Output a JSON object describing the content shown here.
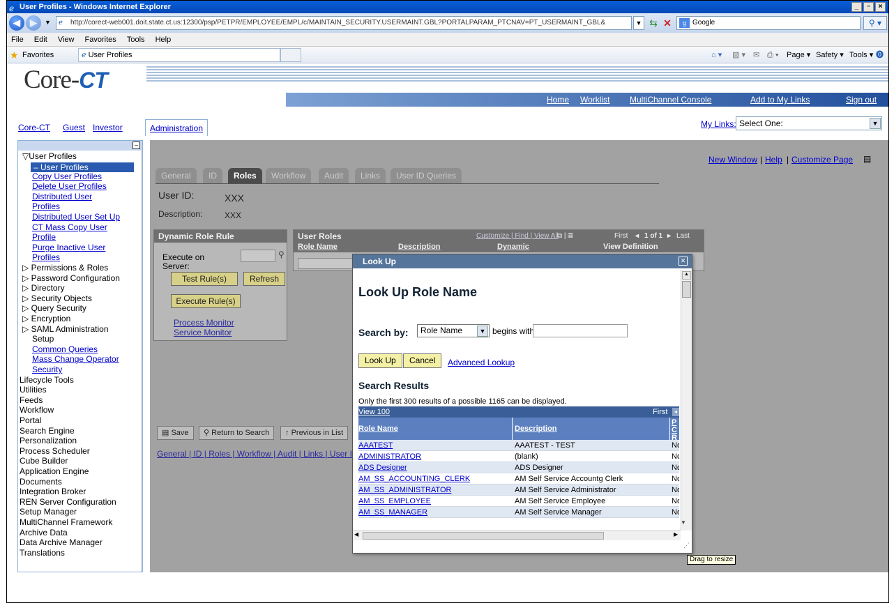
{
  "window": {
    "title": "User Profiles - Windows Internet Explorer"
  },
  "browser": {
    "url": "http://corect-web001.doit.state.ct.us:12300/psp/PETPR/EMPLOYEE/EMPL/c/MAINTAIN_SECURITY.USERMAINT.GBL?PORTALPARAM_PTCNAV=PT_USERMAINT_GBL&",
    "search_engine": "Google",
    "menus": [
      "File",
      "Edit",
      "View",
      "Favorites",
      "Tools",
      "Help"
    ],
    "favorites": "Favorites",
    "tab": "User Profiles",
    "cmd": [
      "Page ▾",
      "Safety ▾",
      "Tools ▾"
    ]
  },
  "header": {
    "logo_text": "Core-",
    "logo_ct": "CT",
    "links": [
      "Home",
      "Worklist",
      "MultiChannel Console",
      "Add to My Links",
      "Sign out"
    ],
    "tabs": [
      "Core-CT",
      "Guest",
      "Investor",
      "Administration"
    ],
    "my_links_label": "My Links:",
    "my_links_value": "Select One:"
  },
  "menu": {
    "items": [
      {
        "label": "▽User Profiles",
        "type": "top"
      },
      {
        "label": "– User Profiles",
        "type": "selected"
      },
      {
        "label": "Copy User Profiles",
        "type": "sub"
      },
      {
        "label": "Delete User Profiles",
        "type": "sub"
      },
      {
        "label": "Distributed User",
        "type": "sub"
      },
      {
        "label": "Profiles",
        "type": "sub"
      },
      {
        "label": "Distributed User Set Up",
        "type": "sub"
      },
      {
        "label": "CT Mass Copy User",
        "type": "sub"
      },
      {
        "label": "Profile",
        "type": "sub"
      },
      {
        "label": "Purge Inactive User",
        "type": "sub"
      },
      {
        "label": "Profiles",
        "type": "sub"
      },
      {
        "label": "▷ Permissions & Roles",
        "type": "top"
      },
      {
        "label": "▷ Password Configuration",
        "type": "top"
      },
      {
        "label": "▷ Directory",
        "type": "top"
      },
      {
        "label": "▷ Security Objects",
        "type": "top"
      },
      {
        "label": "▷ Query Security",
        "type": "top"
      },
      {
        "label": "▷ Encryption",
        "type": "top"
      },
      {
        "label": "▷ SAML Administration",
        "type": "top"
      },
      {
        "label": "Setup",
        "type": "indent"
      },
      {
        "label": "Common Queries",
        "type": "sub"
      },
      {
        "label": "Mass Change Operator",
        "type": "sub"
      },
      {
        "label": "Security",
        "type": "sub"
      },
      {
        "label": "Lifecycle Tools",
        "type": "root"
      },
      {
        "label": "Utilities",
        "type": "root"
      },
      {
        "label": "Feeds",
        "type": "root"
      },
      {
        "label": "Workflow",
        "type": "root"
      },
      {
        "label": "Portal",
        "type": "root"
      },
      {
        "label": "Search Engine",
        "type": "root"
      },
      {
        "label": "Personalization",
        "type": "root"
      },
      {
        "label": "Process Scheduler",
        "type": "root"
      },
      {
        "label": "Cube Builder",
        "type": "root"
      },
      {
        "label": "Application Engine",
        "type": "root"
      },
      {
        "label": "Documents",
        "type": "root"
      },
      {
        "label": "Integration Broker",
        "type": "root"
      },
      {
        "label": "REN Server Configuration",
        "type": "root"
      },
      {
        "label": "Setup Manager",
        "type": "root"
      },
      {
        "label": "MultiChannel Framework",
        "type": "root"
      },
      {
        "label": "Archive Data",
        "type": "root"
      },
      {
        "label": "Data Archive Manager",
        "type": "root"
      },
      {
        "label": "Translations",
        "type": "root"
      }
    ]
  },
  "page": {
    "top_links": [
      "New Window",
      "Help",
      "Customize Page"
    ],
    "tabs": [
      "General",
      "ID",
      "Roles",
      "Workflow",
      "Audit",
      "Links",
      "User ID Queries"
    ],
    "active_tab": "Roles",
    "user_id_label": "User ID:",
    "user_id_value": "XXX",
    "description_label": "Description:",
    "description_value": "XXX",
    "drr_title": "Dynamic Role Rule",
    "execute_on": "Execute on",
    "server": "Server:",
    "test_rules": "Test Rule(s)",
    "refresh": "Refresh",
    "execute_rules": "Execute Rule(s)",
    "process_monitor": "Process Monitor",
    "service_monitor": "Service Monitor",
    "user_roles_title": "User Roles",
    "ur_tools": "Customize | Find | View All",
    "ur_nav": "First",
    "ur_count": "1 of 1",
    "ur_last": "Last",
    "ur_cols": [
      "Role Name",
      "Description",
      "Dynamic",
      "View Definition"
    ],
    "bottom_buttons": [
      "Save",
      "Return to Search",
      "Previous in List"
    ],
    "bottom_links": "General | ID | Roles | Workflow | Audit | Links | User ID"
  },
  "modal": {
    "header": "Look Up",
    "title": "Look Up Role Name",
    "search_by_label": "Search by:",
    "search_by_value": "Role Name",
    "begins_with": "begins with",
    "lookup_btn": "Look Up",
    "cancel_btn": "Cancel",
    "advanced": "Advanced Lookup",
    "results_title": "Search Results",
    "note": "Only the first 300 results of a possible 1165 can be displayed.",
    "view100": "View 100",
    "first": "First",
    "cols": [
      "Role Name",
      "Description",
      "PC Ru"
    ],
    "rows": [
      {
        "name": "AAATEST",
        "desc": "AAATEST - TEST",
        "pc": "No"
      },
      {
        "name": "ADMINISTRATOR",
        "desc": "(blank)",
        "pc": "No"
      },
      {
        "name": "ADS Designer",
        "desc": "ADS Designer",
        "pc": "No"
      },
      {
        "name": "AM_SS_ACCOUNTING_CLERK",
        "desc": "AM Self Service Accountg Clerk",
        "pc": "No"
      },
      {
        "name": "AM_SS_ADMINISTRATOR",
        "desc": "AM Self Service Administrator",
        "pc": "No"
      },
      {
        "name": "AM_SS_EMPLOYEE",
        "desc": "AM Self Service Employee",
        "pc": "No"
      },
      {
        "name": "AM_SS_MANAGER",
        "desc": "AM Self Service Manager",
        "pc": "No"
      }
    ],
    "tooltip": "Drag to resize"
  }
}
